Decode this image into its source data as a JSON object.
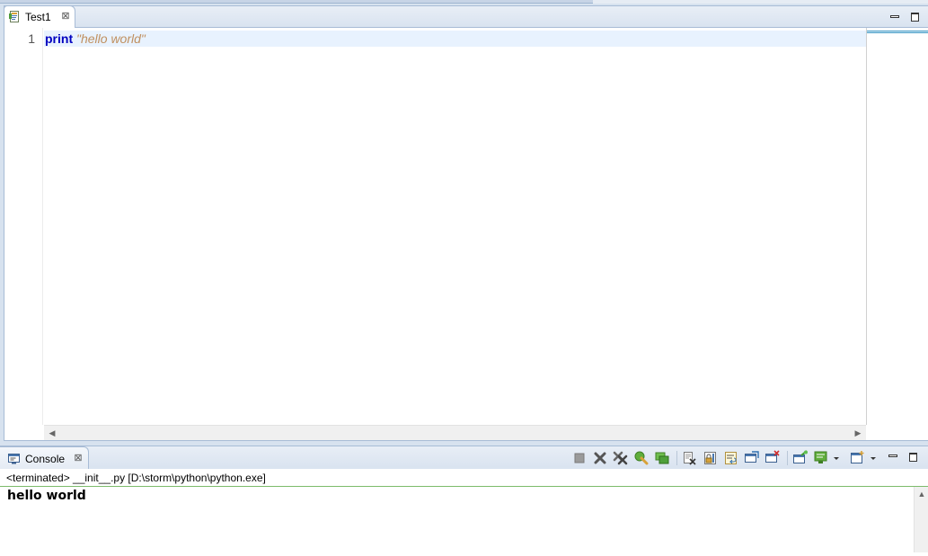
{
  "editor": {
    "tab_label": "Test1",
    "tab_close": "⊠",
    "line_number": "1",
    "code_keyword": "print",
    "code_string": "\"hello world\""
  },
  "console": {
    "tab_label": "Console",
    "tab_close": "⊠",
    "status": "<terminated> __init__.py [D:\\storm\\python\\python.exe]",
    "output": "hello world"
  },
  "icons": {
    "editor_tab": "python-file-icon",
    "console_tab": "console-icon",
    "toolbar": [
      "terminate-icon",
      "remove-launch-icon",
      "remove-all-terminated-icon",
      "pin-console-icon",
      "display-selected-console-icon",
      "clear-console-icon",
      "scroll-lock-icon",
      "word-wrap-icon",
      "show-on-stdout-icon",
      "show-on-stderr-icon",
      "open-console-icon",
      "open-console-dropdown-icon",
      "new-console-icon",
      "new-console-dropdown-icon"
    ]
  },
  "colors": {
    "keyword": "#0000c0",
    "string": "#c09060",
    "current_line": "#e8f2fe",
    "status_rule": "#7dbb6b"
  }
}
